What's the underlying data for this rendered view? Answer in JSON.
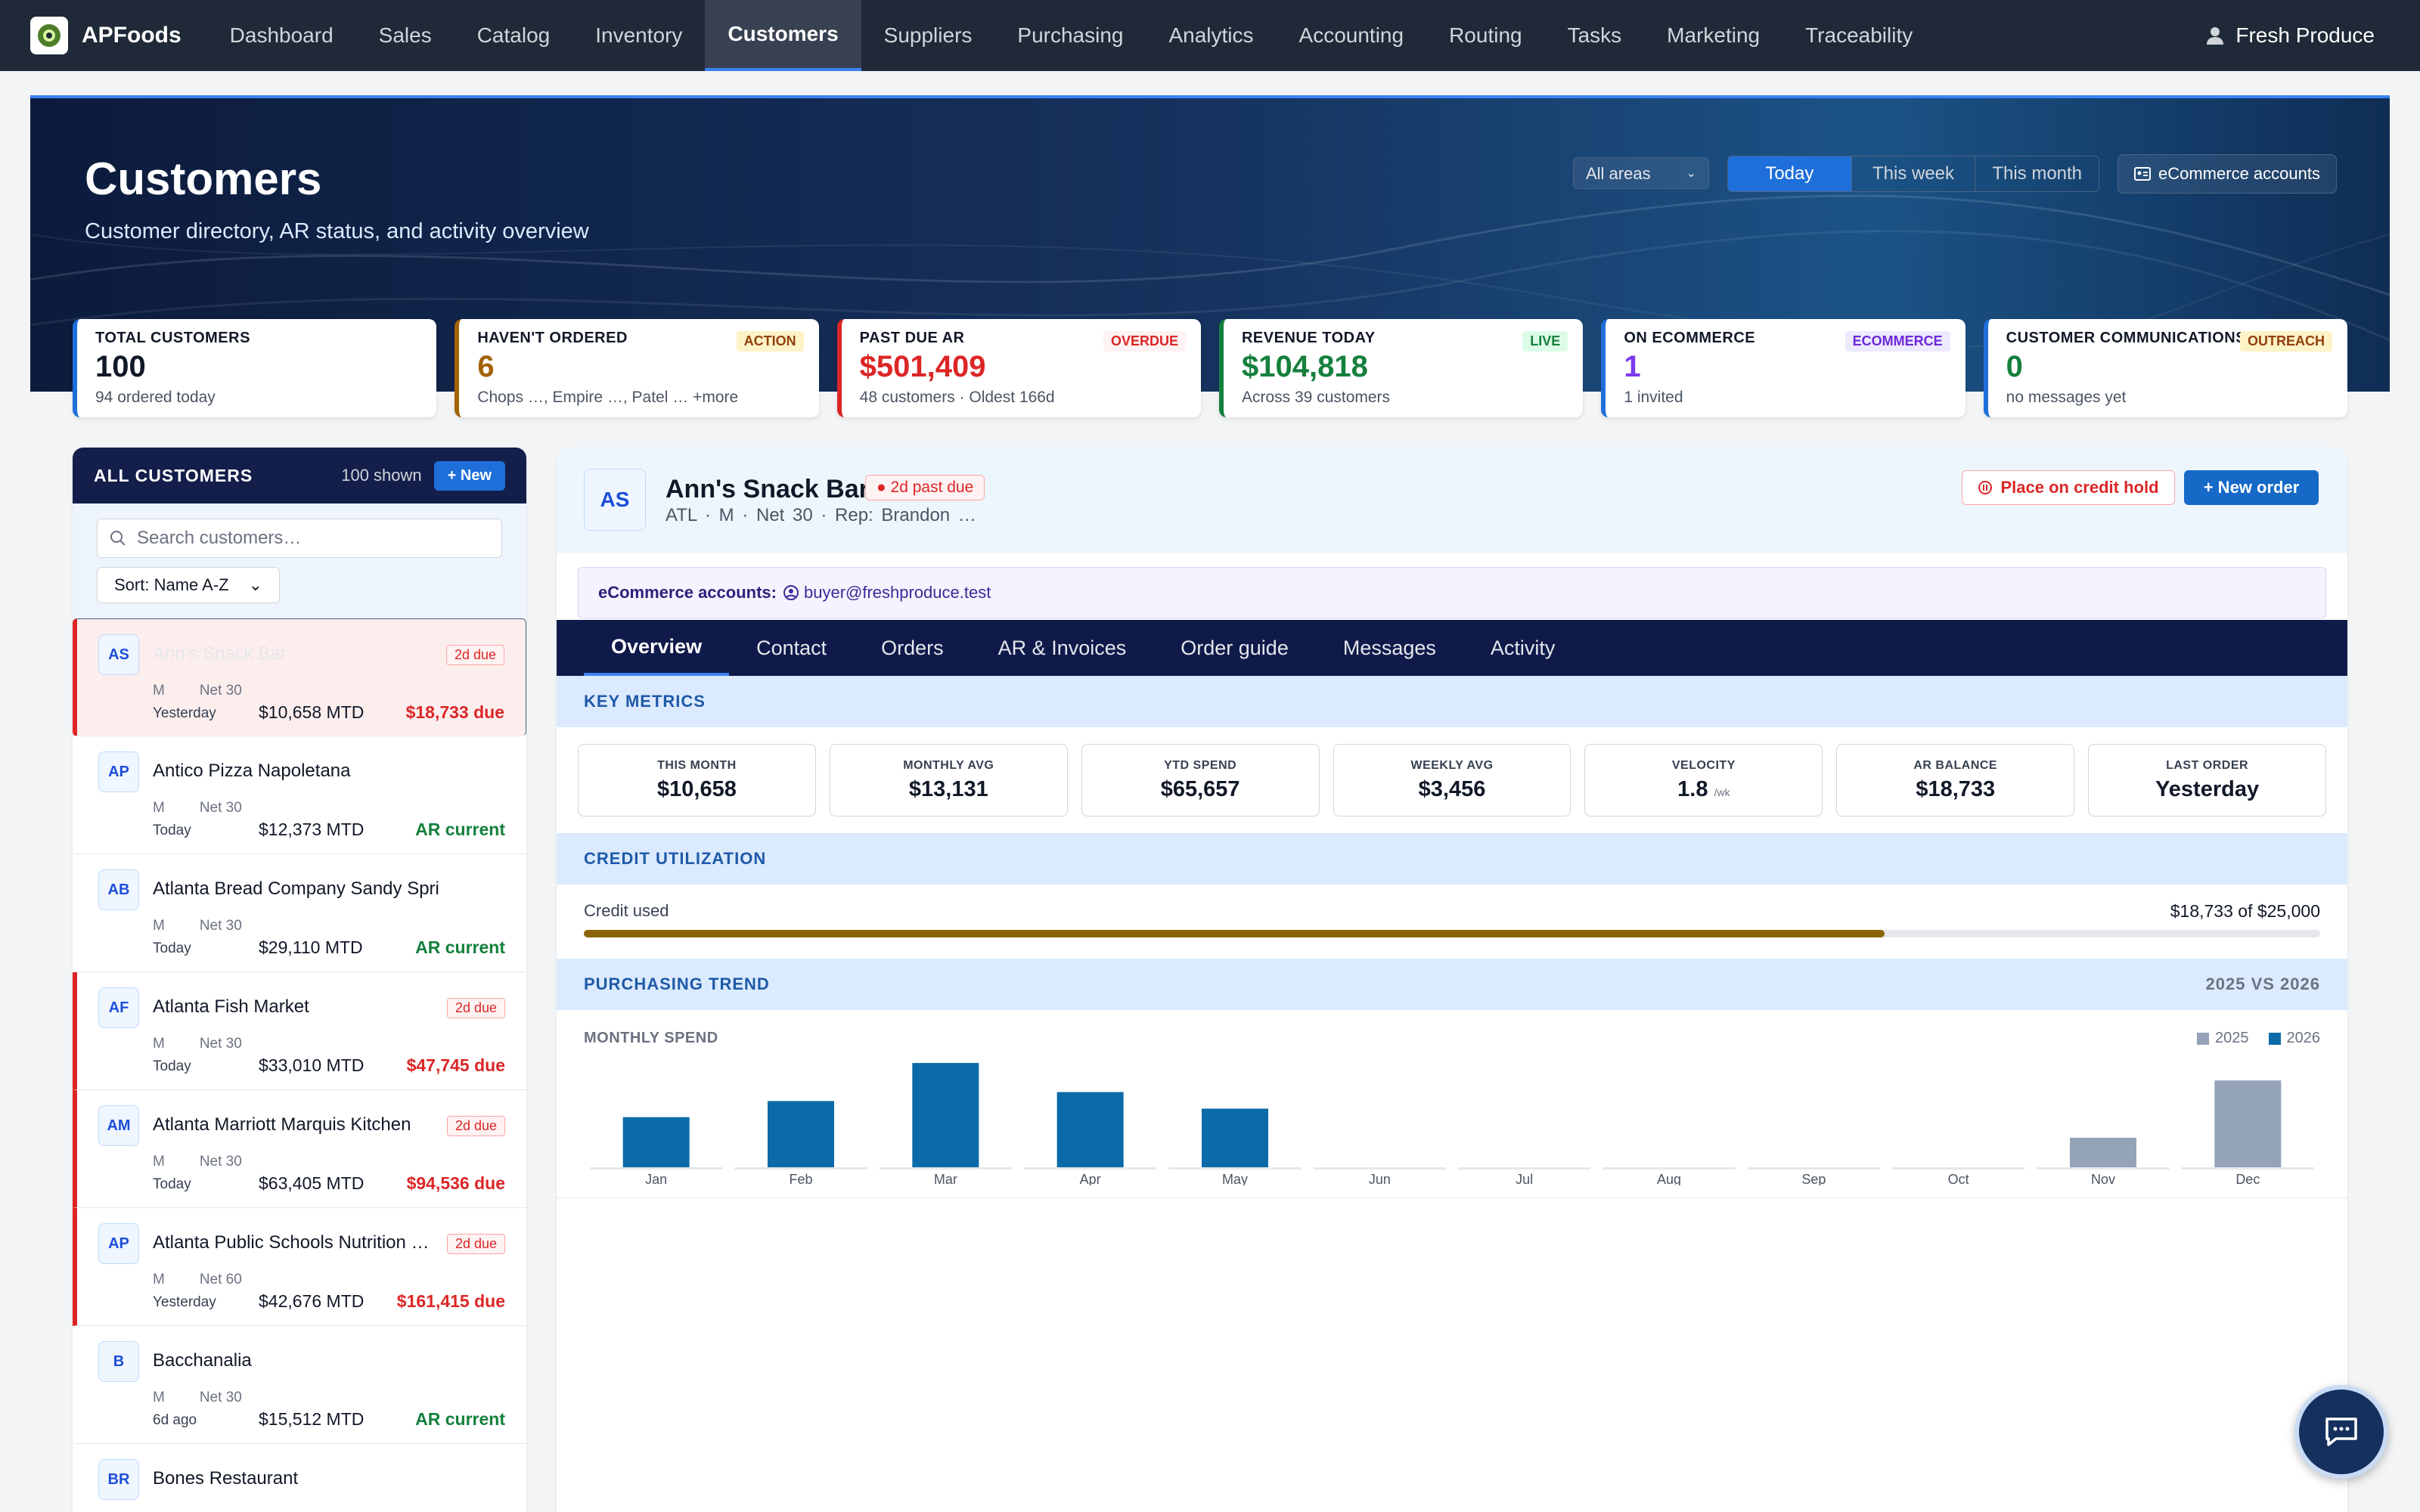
{
  "app": {
    "name": "APFoods",
    "user": "Fresh Produce"
  },
  "nav": [
    {
      "label": "Dashboard"
    },
    {
      "label": "Sales"
    },
    {
      "label": "Catalog"
    },
    {
      "label": "Inventory"
    },
    {
      "label": "Customers"
    },
    {
      "label": "Suppliers"
    },
    {
      "label": "Purchasing"
    },
    {
      "label": "Analytics"
    },
    {
      "label": "Accounting"
    },
    {
      "label": "Routing"
    },
    {
      "label": "Tasks"
    },
    {
      "label": "Marketing"
    },
    {
      "label": "Traceability"
    }
  ],
  "hero": {
    "title": "Customers",
    "subtitle": "Customer directory, AR status, and activity overview",
    "area_select": "All areas",
    "ranges": [
      "Today",
      "This week",
      "This month"
    ],
    "ecom_button": "eCommerce accounts"
  },
  "kpis": [
    {
      "label": "TOTAL CUSTOMERS",
      "value": "100",
      "sub": "94 ordered today",
      "tag": "",
      "color": "#1e6fd9",
      "valcolor": "#111827",
      "tagbg": "",
      "tagfg": ""
    },
    {
      "label": "HAVEN'T ORDERED",
      "value": "6",
      "sub": "Chops …, Empire …, Patel … +more",
      "tag": "ACTION",
      "color": "#a16207",
      "valcolor": "#a16207",
      "tagbg": "#fef3c7",
      "tagfg": "#92400e"
    },
    {
      "label": "PAST DUE AR",
      "value": "$501,409",
      "sub": "48 customers · Oldest 166d",
      "tag": "OVERDUE",
      "color": "#dc2626",
      "valcolor": "#dc2626",
      "tagbg": "#fef2f2",
      "tagfg": "#dc2626"
    },
    {
      "label": "REVENUE TODAY",
      "value": "$104,818",
      "sub": "Across 39 customers",
      "tag": "LIVE",
      "color": "#15803d",
      "valcolor": "#15803d",
      "tagbg": "#dcfce7",
      "tagfg": "#15803d"
    },
    {
      "label": "ON ECOMMERCE",
      "value": "1",
      "sub": "1 invited",
      "tag": "ECOMMERCE",
      "color": "#1e6fd9",
      "valcolor": "#7c3aed",
      "tagbg": "#ede9fe",
      "tagfg": "#6d28d9"
    },
    {
      "label": "CUSTOMER COMMUNICATIONS",
      "value": "0",
      "sub": "no messages yet",
      "tag": "OUTREACH",
      "color": "#1e6fd9",
      "valcolor": "#15803d",
      "tagbg": "#fef3c7",
      "tagfg": "#92400e"
    }
  ],
  "list": {
    "title": "ALL CUSTOMERS",
    "count": "100 shown",
    "new_button": "+ New",
    "search_placeholder": "Search customers…",
    "sort": "Sort: Name A-Z",
    "rows": [
      {
        "initials": "AS",
        "name": "Ann's Snack Bar",
        "badge": "2d due",
        "size": "M",
        "terms": "Net 30",
        "last": "Yesterday",
        "mtd": "$10,658 MTD",
        "status": "$18,733 due",
        "status_color": "#dc2626"
      },
      {
        "initials": "AP",
        "name": "Antico Pizza Napoletana",
        "badge": "",
        "size": "M",
        "terms": "Net 30",
        "last": "Today",
        "mtd": "$12,373 MTD",
        "status": "AR current",
        "status_color": "#15803d"
      },
      {
        "initials": "AB",
        "name": "Atlanta Bread Company Sandy Springs",
        "badge": "",
        "size": "M",
        "terms": "Net 30",
        "last": "Today",
        "mtd": "$29,110 MTD",
        "status": "AR current",
        "status_color": "#15803d"
      },
      {
        "initials": "AF",
        "name": "Atlanta Fish Market",
        "badge": "2d due",
        "size": "M",
        "terms": "Net 30",
        "last": "Today",
        "mtd": "$33,010 MTD",
        "status": "$47,745 due",
        "status_color": "#dc2626"
      },
      {
        "initials": "AM",
        "name": "Atlanta Marriott Marquis Kitchen",
        "badge": "2d due",
        "size": "M",
        "terms": "Net 30",
        "last": "Today",
        "mtd": "$63,405 MTD",
        "status": "$94,536 due",
        "status_color": "#dc2626"
      },
      {
        "initials": "AP",
        "name": "Atlanta Public Schools Nutrition …",
        "badge": "2d due",
        "size": "M",
        "terms": "Net 60",
        "last": "Yesterday",
        "mtd": "$42,676 MTD",
        "status": "$161,415 due",
        "status_color": "#dc2626"
      },
      {
        "initials": "B",
        "name": "Bacchanalia",
        "badge": "",
        "size": "M",
        "terms": "Net 30",
        "last": "6d ago",
        "mtd": "$15,512 MTD",
        "status": "AR current",
        "status_color": "#15803d"
      },
      {
        "initials": "BR",
        "name": "Bones Restaurant",
        "badge": "",
        "size": "",
        "terms": "",
        "last": "",
        "mtd": "",
        "status": "",
        "status_color": "#15803d"
      }
    ]
  },
  "detail": {
    "initials": "AS",
    "name": "Ann's Snack Bar",
    "past_due": "2d past due",
    "meta": "ATL · M · Net 30 · Rep: Brandon …",
    "hold_button": "Place on credit hold",
    "new_order_button": "+ New order",
    "ecom_label": "eCommerce accounts:",
    "ecom_account": "buyer@freshproduce.test",
    "tabs": [
      "Overview",
      "Contact",
      "Orders",
      "AR & Invoices",
      "Order guide",
      "Messages",
      "Activity"
    ],
    "key_metrics_title": "KEY METRICS",
    "metrics": [
      {
        "label": "THIS MONTH",
        "value": "$10,658",
        "unit": ""
      },
      {
        "label": "MONTHLY AVG",
        "value": "$13,131",
        "unit": ""
      },
      {
        "label": "YTD SPEND",
        "value": "$65,657",
        "unit": ""
      },
      {
        "label": "WEEKLY AVG",
        "value": "$3,456",
        "unit": ""
      },
      {
        "label": "VELOCITY",
        "value": "1.8",
        "unit": "/wk"
      },
      {
        "label": "AR BALANCE",
        "value": "$18,733",
        "unit": ""
      },
      {
        "label": "LAST ORDER",
        "value": "Yesterday",
        "unit": ""
      }
    ],
    "credit_title": "CREDIT UTILIZATION",
    "credit_label": "Credit used",
    "credit_value": "$18,733 of $25,000",
    "credit_used": 18733,
    "credit_limit": 25000,
    "trend_title": "PURCHASING TREND",
    "trend_compare": "2025 VS 2026",
    "monthly_label": "MONTHLY SPEND"
  },
  "chart_data": {
    "type": "bar",
    "categories": [
      "Jan",
      "Feb",
      "Mar",
      "Apr",
      "May",
      "Jun",
      "Jul",
      "Aug",
      "Sep",
      "Oct",
      "Nov",
      "Dec"
    ],
    "series": [
      {
        "name": "2025",
        "color": "#94a3b8",
        "values": [
          0,
          0,
          0,
          0,
          0,
          0,
          0,
          0,
          0,
          0,
          6.6,
          19.4
        ]
      },
      {
        "name": "2026",
        "color": "#0b6aa8",
        "values": [
          11.2,
          14.8,
          23.3,
          16.8,
          13.1,
          0,
          0,
          0,
          0,
          0,
          0,
          0
        ]
      }
    ],
    "ylim": [
      0,
      25
    ]
  },
  "icons": {
    "chat": "chat-icon",
    "user": "user-icon",
    "search": "search-icon"
  }
}
